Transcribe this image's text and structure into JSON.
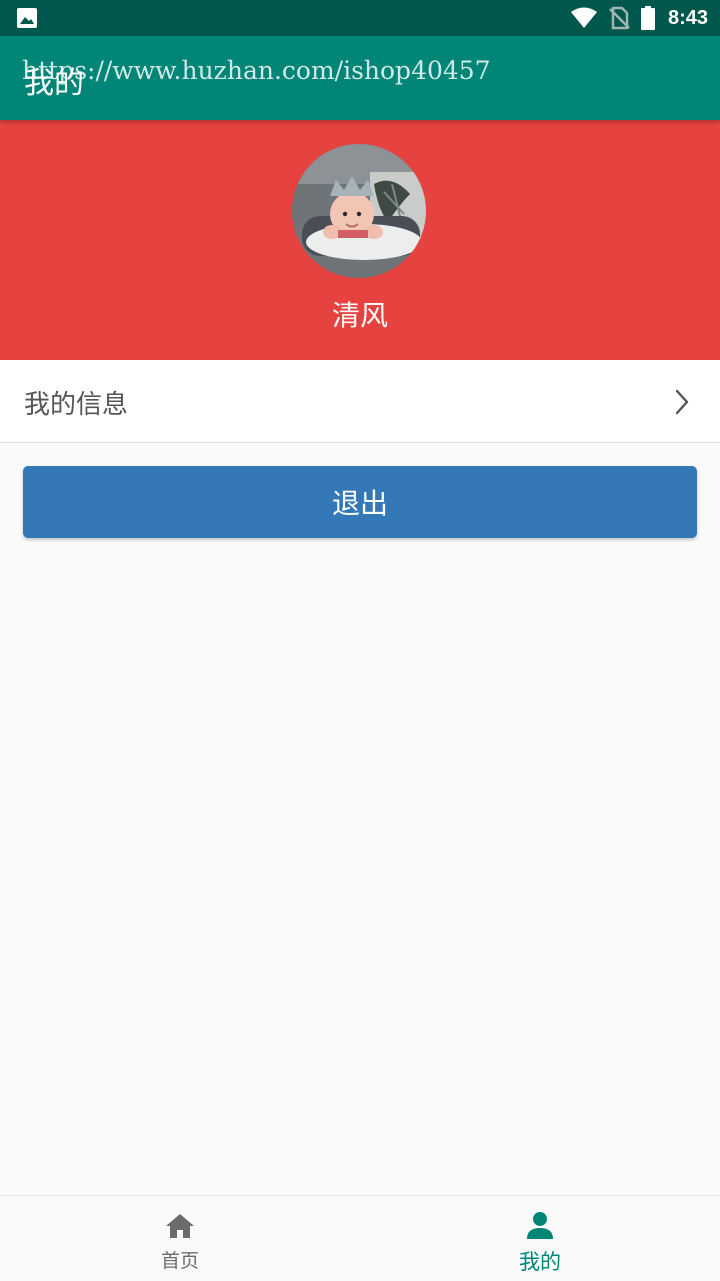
{
  "status_bar": {
    "time": "8:43",
    "icons": [
      "gallery-notification-icon",
      "wifi-icon",
      "no-sim-icon",
      "battery-icon"
    ]
  },
  "app_bar": {
    "title": "我的",
    "watermark": "https://www.huzhan.com/ishop40457",
    "color": "#008577"
  },
  "profile": {
    "name": "清风",
    "background_color": "#e64340",
    "avatar": "baby-avatar-image"
  },
  "menu": {
    "my_info_label": "我的信息",
    "chevron_icon": "chevron-right-icon"
  },
  "logout": {
    "label": "退出",
    "color": "#3478b8"
  },
  "bottom_nav": {
    "items": [
      {
        "label": "首页",
        "icon": "home-icon",
        "active": false
      },
      {
        "label": "我的",
        "icon": "person-icon",
        "active": true
      }
    ],
    "active_color": "#008577",
    "inactive_color": "#6b6b6b"
  }
}
